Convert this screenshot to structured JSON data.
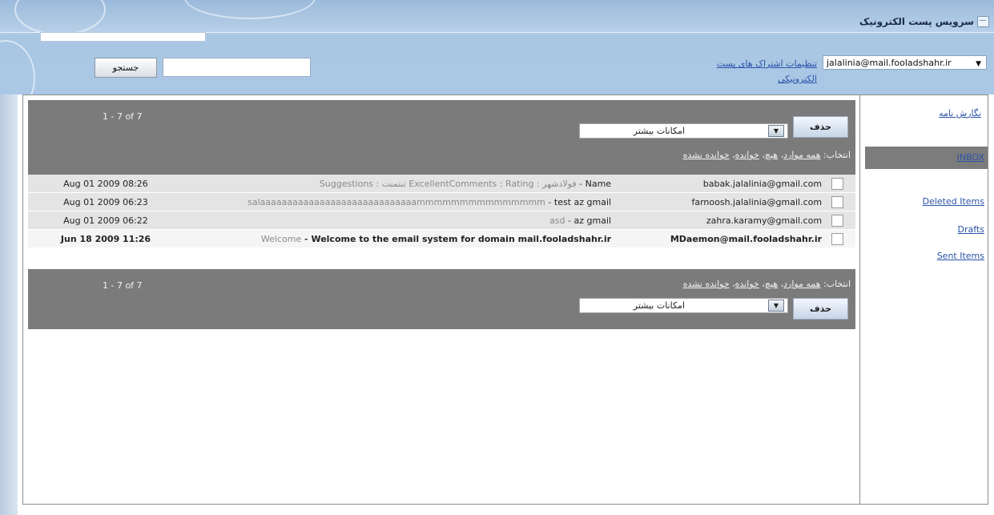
{
  "header": {
    "app_title": "سرویس پست الکترونیک",
    "account": "jalalinia@mail.fooladshahr.ir",
    "account_settings_link": "تنظیمات اشتراک های پست الکترونیکی",
    "search_button": "جستجو",
    "search_value": ""
  },
  "sidebar": {
    "compose": "نگارش نامه",
    "folders": [
      "INBOX",
      "Deleted Items",
      "Drafts",
      "Sent Items"
    ],
    "selected": "INBOX"
  },
  "toolbar": {
    "pager": "1 - 7 of 7",
    "delete_button": "حذف",
    "more_actions": "امکانات بیشتر",
    "select_label": "انتخاب:",
    "select_all": "همه موارد",
    "select_none": "هیچ",
    "select_read": "خوانده",
    "select_unread": "خوانده نشده"
  },
  "emails": [
    {
      "from": "babak.jalalinia@gmail.com",
      "subject": "Name",
      "preview": "Suggestions : تنتمنت ExcellentComments : Rating : فولادشهر",
      "date": "Aug 01 2009 08:26",
      "unread": false
    },
    {
      "from": "farnoosh.jalalinia@gmail.com",
      "subject": "test az gmail",
      "preview": "salaaaaaaaaaaaaaaaaaaaaaaaaaaaaammmmmmmmmmmmmmm",
      "date": "Aug 01 2009 06:23",
      "unread": false
    },
    {
      "from": "zahra.karamy@gmail.com",
      "subject": "az gmail",
      "preview": "asd",
      "date": "Aug 01 2009 06:22",
      "unread": false
    },
    {
      "from": "MDaemon@mail.fooladshahr.ir",
      "subject": "Welcome to the email system for domain mail.fooladshahr.ir",
      "preview": "Welcome",
      "date": "Jun 18 2009 11:26",
      "unread": true
    }
  ]
}
